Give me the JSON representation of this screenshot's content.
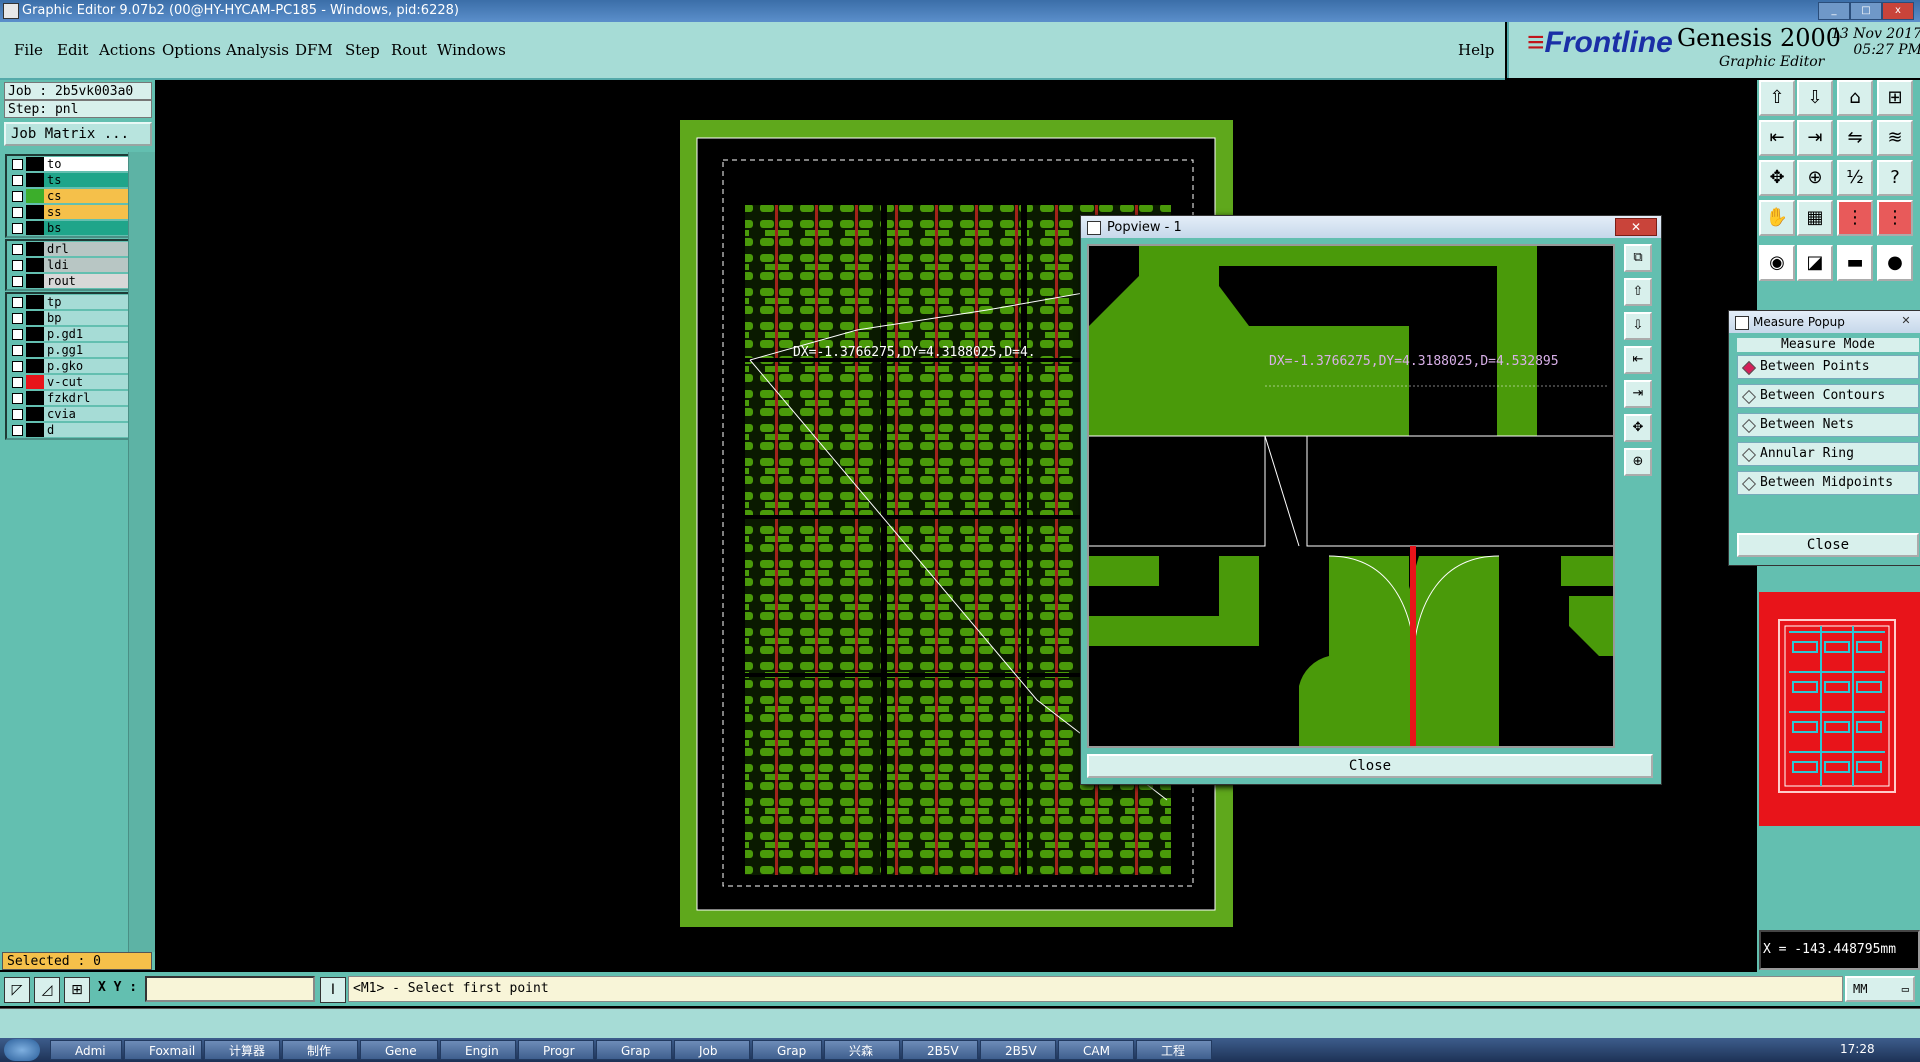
{
  "window": {
    "title": "Graphic Editor 9.07b2 (00@HY-HYCAM-PC185 - Windows, pid:6228)",
    "min": "_",
    "max": "□",
    "close": "x"
  },
  "menu": [
    "File",
    "Edit",
    "Actions",
    "Options",
    "Analysis",
    "DFM",
    "Step",
    "Rout",
    "Windows"
  ],
  "help": "Help",
  "brand": {
    "logo": "Frontline",
    "product": "Genesis 2000",
    "subtitle": "Graphic Editor",
    "date": "13 Nov 2017",
    "time": "05:27 PM"
  },
  "job": {
    "job_line": "Job : 2b5vk003a0",
    "step_line": "Step: pnl",
    "matrix_button": "Job Matrix ..."
  },
  "layers_group1": [
    {
      "name": "to",
      "color": "#ffffff",
      "swatch": "#000000"
    },
    {
      "name": "ts",
      "color": "#1fa58a",
      "swatch": "#000000"
    },
    {
      "name": "cs",
      "color": "#f5c04a",
      "swatch": "#3cae2b"
    },
    {
      "name": "ss",
      "color": "#f5c04a",
      "swatch": "#000000"
    },
    {
      "name": "bs",
      "color": "#1fa58a",
      "swatch": "#000000"
    }
  ],
  "layers_group2": [
    {
      "name": "drl",
      "color": "#b8c6c4",
      "swatch": "#000000"
    },
    {
      "name": "ldi",
      "color": "#b8c6c4",
      "swatch": "#000000"
    },
    {
      "name": "rout",
      "color": "#d8d8d8",
      "swatch": "#000000"
    }
  ],
  "layers_group3": [
    {
      "name": "tp",
      "color": "#a6dcd6",
      "swatch": "#000000"
    },
    {
      "name": "bp",
      "color": "#a6dcd6",
      "swatch": "#000000"
    },
    {
      "name": "p.gd1",
      "color": "#a6dcd6",
      "swatch": "#000000"
    },
    {
      "name": "p.gg1",
      "color": "#a6dcd6",
      "swatch": "#000000"
    },
    {
      "name": "p.gko",
      "color": "#a6dcd6",
      "swatch": "#000000"
    },
    {
      "name": "v-cut",
      "color": "#a6dcd6",
      "swatch": "#e8141a"
    },
    {
      "name": "fzkdrl",
      "color": "#a6dcd6",
      "swatch": "#000000"
    },
    {
      "name": "cvia",
      "color": "#a6dcd6",
      "swatch": "#000000"
    },
    {
      "name": "d",
      "color": "#a6dcd6",
      "swatch": "#000000"
    }
  ],
  "selected": "Selected : 0",
  "canvas_label": "DX=-1.3766275,DY=4.3188025,D=4.",
  "popview": {
    "title": "Popview - 1",
    "measurement": "DX=-1.3766275,DY=4.3188025,D=4.532895",
    "close": "Close",
    "tools": [
      "zoom-home-icon",
      "zoom-in-icon",
      "zoom-out-icon",
      "pan-left-icon",
      "pan-right-icon",
      "fit-icon",
      "center-icon"
    ]
  },
  "measure_popup": {
    "title": "Measure Popup",
    "mode_label": "Measure Mode",
    "options": [
      "Between Points",
      "Between Contours",
      "Between Nets",
      "Annular Ring",
      "Between Midpoints"
    ],
    "selected_option": "Between Points",
    "close": "Close"
  },
  "coord_readout": "X = -143.448795mm",
  "bottom": {
    "xy_label": "X Y :",
    "prompt": "<M1> - Select first point",
    "units": "MM"
  },
  "taskbar": {
    "items": [
      "Admi",
      "Foxmail",
      "计算器",
      "制作",
      "Gene",
      "Engin",
      "Progr",
      "Grap",
      "Job",
      "Grap",
      "兴森",
      "2B5V",
      "2B5V",
      "CAM",
      "工程"
    ],
    "clock": "17:28"
  },
  "colors": {
    "panel": "#63bfb0",
    "menubar": "#a6dcd6",
    "copper": "#4a9a0a",
    "board": "#5fa81c"
  }
}
